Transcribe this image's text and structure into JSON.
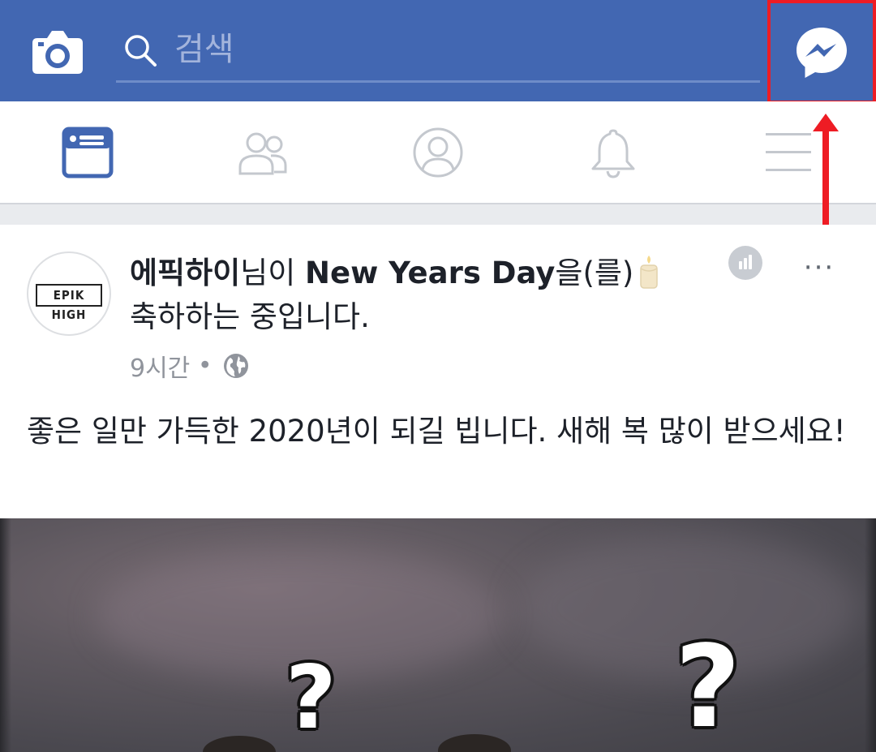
{
  "search": {
    "placeholder": "검색"
  },
  "colors": {
    "brand": "#4267b2",
    "annotation": "#ee1c24",
    "active_tab": "#4267b2",
    "inactive_tab": "#c4c8ce"
  },
  "icons": {
    "camera": "camera-icon",
    "search": "search-icon",
    "messenger": "messenger-icon",
    "news_feed": "news-feed-icon",
    "friends": "friends-icon",
    "profile": "profile-icon",
    "notifications": "bell-icon",
    "menu": "menu-icon"
  },
  "post": {
    "author": "에픽하이",
    "author_suffix": "님이 ",
    "event": "New Years Day",
    "event_suffix": "을(를)",
    "activity_line": "축하하는 중입니다.",
    "avatar_text": "EPIK HIGH",
    "time": "9시간",
    "separator": "•",
    "more": "···",
    "text": "좋은 일만 가득한 2020년이 되길 빕니다. 새해 복 많이 받으세요!"
  },
  "image": {
    "marks": [
      "?",
      "?"
    ]
  }
}
